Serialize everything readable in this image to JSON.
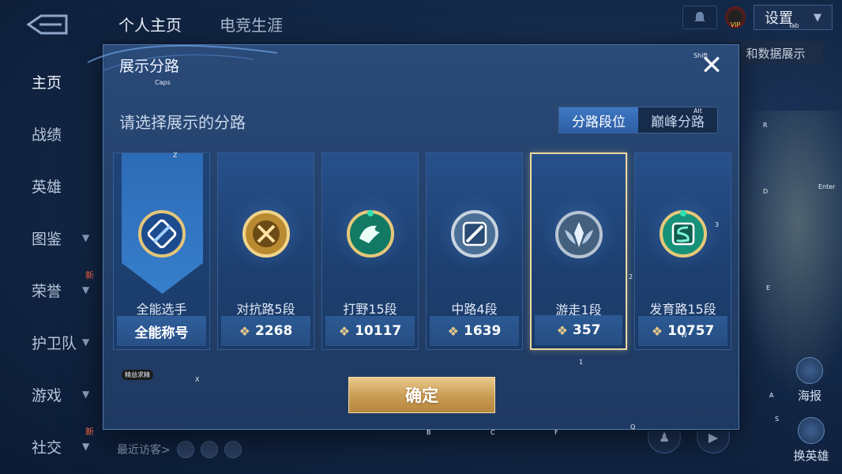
{
  "top_nav": {
    "tabs": [
      "个人主页",
      "电竞生涯"
    ],
    "active_tab": 0
  },
  "top_right": {
    "vip_label": "VIP",
    "settings_label": "设置",
    "behind_label": "和数据展示"
  },
  "left_nav": {
    "items": [
      {
        "label": "主页",
        "active": true,
        "chevron": false,
        "new": false
      },
      {
        "label": "战绩",
        "active": false,
        "chevron": false,
        "new": false
      },
      {
        "label": "英雄",
        "active": false,
        "chevron": false,
        "new": false
      },
      {
        "label": "图鉴",
        "active": false,
        "chevron": true,
        "new": false
      },
      {
        "label": "荣誉",
        "active": false,
        "chevron": true,
        "new": true
      },
      {
        "label": "护卫队",
        "active": false,
        "chevron": true,
        "new": false
      },
      {
        "label": "游戏",
        "active": false,
        "chevron": true,
        "new": false
      },
      {
        "label": "社交",
        "active": false,
        "chevron": true,
        "new": true
      }
    ],
    "new_label": "新"
  },
  "footer": {
    "visitors_label": "最近访客>"
  },
  "right_panel": {
    "poster_label": "海报",
    "swap_hero_label": "换英雄"
  },
  "modal": {
    "title": "展示分路",
    "close_icon": "close-icon",
    "subtitle": "请选择展示的分路",
    "segments": [
      {
        "label": "分路段位",
        "active": true
      },
      {
        "label": "巅峰分路",
        "active": false
      }
    ],
    "cards": [
      {
        "name": "全能选手",
        "stat": "全能称号",
        "has_leaf": false,
        "icon": "all-rounder-badge-icon",
        "badge_color": "#3b7fd0",
        "selected": false
      },
      {
        "name": "对抗路5段",
        "stat": "2268",
        "has_leaf": true,
        "icon": "clash-lane-badge-icon",
        "badge_color": "#d9a441",
        "selected": false
      },
      {
        "name": "打野15段",
        "stat": "10117",
        "has_leaf": true,
        "icon": "jungle-badge-icon",
        "badge_color": "#1fae8c",
        "selected": false
      },
      {
        "name": "中路4段",
        "stat": "1639",
        "has_leaf": true,
        "icon": "mid-lane-badge-icon",
        "badge_color": "#8aa9c9",
        "selected": false
      },
      {
        "name": "游走1段",
        "stat": "357",
        "has_leaf": true,
        "icon": "roam-badge-icon",
        "badge_color": "#7f98b6",
        "selected": true
      },
      {
        "name": "发育路15段",
        "stat": "10757",
        "has_leaf": true,
        "icon": "farm-lane-badge-icon",
        "badge_color": "#2ec7a6",
        "selected": false
      }
    ],
    "confirm_label": "确定"
  },
  "key_hints": [
    {
      "text": "Caps"
    },
    {
      "text": "Shift"
    },
    {
      "text": "Tab"
    },
    {
      "text": "Alt"
    },
    {
      "text": "Z"
    },
    {
      "text": "R"
    },
    {
      "text": "D"
    },
    {
      "text": "Enter"
    },
    {
      "text": "3"
    },
    {
      "text": "2"
    },
    {
      "text": "E"
    },
    {
      "text": "W"
    },
    {
      "text": "1"
    },
    {
      "text": "X"
    },
    {
      "text": "B"
    },
    {
      "text": "C"
    },
    {
      "text": "F"
    },
    {
      "text": "Q"
    },
    {
      "text": "A"
    },
    {
      "text": "S"
    },
    {
      "text": "精益求精"
    }
  ],
  "colors": {
    "accent_gold": "#e7c889",
    "selected_border": "#efd9a0",
    "active_segment": "#3f78c4"
  }
}
